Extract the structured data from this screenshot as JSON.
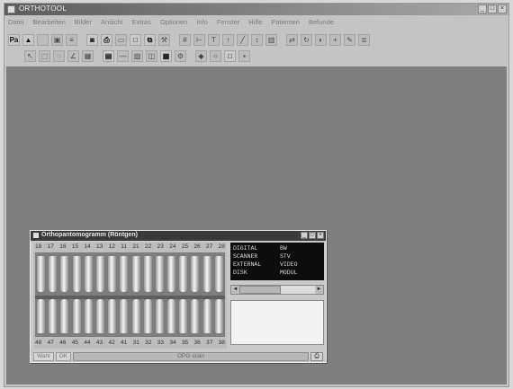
{
  "window": {
    "title": "ORTHOTOOL",
    "min": "_",
    "max": "□",
    "close": "×"
  },
  "menu": [
    "Datei",
    "Bearbeiten",
    "Bilder",
    "Ansicht",
    "Extras",
    "Optionen",
    "Info",
    "Fenster",
    "Hilfe",
    "Patienten",
    "Befunde"
  ],
  "toolbar1": [
    {
      "icon": "patient-icon",
      "glyph": "Pa"
    },
    {
      "icon": "open-icon",
      "glyph": "▲"
    },
    {
      "icon": "blank-icon",
      "glyph": ""
    },
    {
      "icon": "xray-icon",
      "glyph": "▣"
    },
    {
      "icon": "list-icon",
      "glyph": "≡"
    },
    {
      "icon": "camera-icon",
      "glyph": "◙"
    },
    {
      "icon": "printer-icon",
      "glyph": "⎙"
    },
    {
      "icon": "monitor-icon",
      "glyph": "▭"
    },
    {
      "icon": "window-icon",
      "glyph": "□"
    },
    {
      "icon": "copy-icon",
      "glyph": "⧉"
    },
    {
      "icon": "tools-icon",
      "glyph": "⚒"
    },
    {
      "icon": "grid-icon",
      "glyph": "#"
    },
    {
      "icon": "ruler-icon",
      "glyph": "⊢"
    },
    {
      "icon": "text-icon",
      "glyph": "T"
    },
    {
      "icon": "arrow-icon",
      "glyph": "↑"
    },
    {
      "icon": "line-icon",
      "glyph": "╱"
    },
    {
      "icon": "measure-icon",
      "glyph": "↕"
    },
    {
      "icon": "chart-icon",
      "glyph": "▥"
    },
    {
      "icon": "flip-icon",
      "glyph": "⇄"
    },
    {
      "icon": "rotate-icon",
      "glyph": "↻"
    },
    {
      "icon": "contrast-icon",
      "glyph": "◐"
    },
    {
      "icon": "zoom-in-icon",
      "glyph": "+"
    },
    {
      "icon": "pen-icon",
      "glyph": "✎"
    },
    {
      "icon": "filter-icon",
      "glyph": "≣"
    }
  ],
  "toolbar2": [
    {
      "icon": "pointer-icon",
      "glyph": "↖"
    },
    {
      "icon": "select-icon",
      "glyph": "⬚"
    },
    {
      "icon": "lasso-icon",
      "glyph": "◌"
    },
    {
      "icon": "measure-angle-icon",
      "glyph": "∠"
    },
    {
      "icon": "calc-icon",
      "glyph": "▦"
    },
    {
      "icon": "tile-icon",
      "glyph": "▤"
    },
    {
      "icon": "hline-icon",
      "glyph": "—"
    },
    {
      "icon": "image-icon",
      "glyph": "▨"
    },
    {
      "icon": "compare-icon",
      "glyph": "◫"
    },
    {
      "icon": "layout-icon",
      "glyph": "▦"
    },
    {
      "icon": "settings-icon",
      "glyph": "⚙"
    },
    {
      "icon": "mark-icon",
      "glyph": "◆"
    },
    {
      "icon": "circle-icon",
      "glyph": "○"
    },
    {
      "icon": "square-icon",
      "glyph": "□"
    },
    {
      "icon": "save-icon",
      "glyph": "▪"
    }
  ],
  "xray_window": {
    "title": "Orthopantomogramm (Röntgen)",
    "upper_numbers": [
      "18",
      "17",
      "16",
      "15",
      "14",
      "13",
      "12",
      "11",
      "21",
      "22",
      "23",
      "24",
      "25",
      "26",
      "27",
      "28"
    ],
    "lower_numbers": [
      "48",
      "47",
      "46",
      "45",
      "44",
      "43",
      "42",
      "41",
      "31",
      "32",
      "33",
      "34",
      "35",
      "36",
      "37",
      "38"
    ],
    "info": [
      {
        "k": "DIGITAL",
        "v": "BW"
      },
      {
        "k": "SCANNER",
        "v": "STV"
      },
      {
        "k": "EXTERNAL",
        "v": "VIDEO"
      },
      {
        "k": "DISK",
        "v": "MODUL"
      }
    ],
    "status": {
      "btn1": "Wahl",
      "btn2": "OK",
      "field": "OPG scan"
    }
  },
  "colors": {
    "workspace": "#7f7f7f",
    "title_active": "#3a3a3a",
    "info_bg": "#0d0d0d"
  }
}
